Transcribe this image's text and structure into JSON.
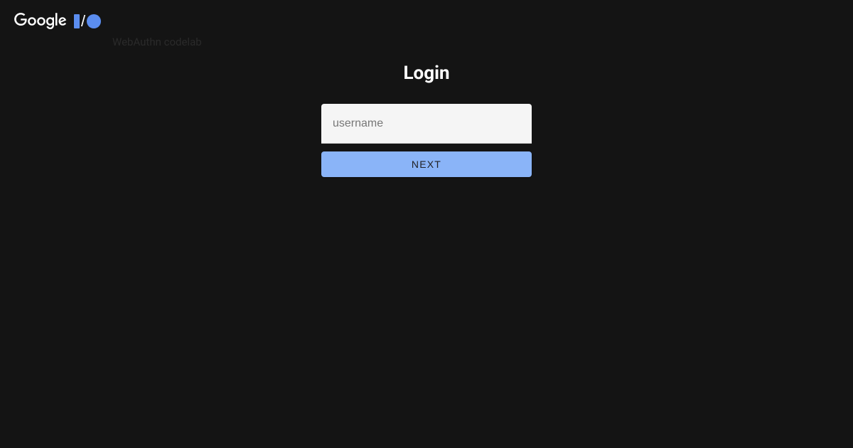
{
  "header": {
    "logo_text": "Google",
    "subtitle": "WebAuthn codelab"
  },
  "main": {
    "title": "Login",
    "form": {
      "username_placeholder": "username",
      "username_value": "",
      "next_button_label": "NEXT"
    }
  },
  "colors": {
    "background": "#141414",
    "accent": "#8ab4f8",
    "io_blue": "#5b8def",
    "input_bg": "#f5f5f5"
  }
}
